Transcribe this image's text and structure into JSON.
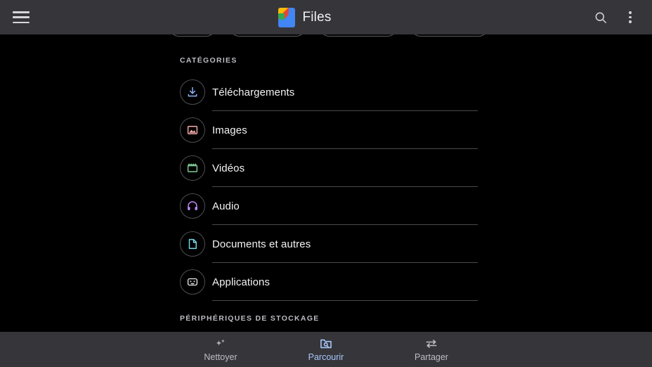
{
  "app": {
    "title": "Files",
    "logo_icon": "files-logo",
    "menu_icon": "hamburger-menu-icon",
    "search_icon": "search-icon",
    "overflow_icon": "more-vert-icon",
    "appbar_color": "#35353a",
    "background_color": "#000000"
  },
  "filter_chips": [
    {
      "name": "chip-1"
    },
    {
      "name": "chip-2"
    },
    {
      "name": "chip-3"
    },
    {
      "name": "chip-4"
    }
  ],
  "sections": {
    "categories_label": "CATÉGORIES",
    "storage_label": "PÉRIPHÉRIQUES DE STOCKAGE"
  },
  "categories": [
    {
      "label": "Téléchargements",
      "icon": "download-icon",
      "color": "#8ab4f8"
    },
    {
      "label": "Images",
      "icon": "image-icon",
      "color": "#f6aea9"
    },
    {
      "label": "Vidéos",
      "icon": "video-icon",
      "color": "#81c995"
    },
    {
      "label": "Audio",
      "icon": "headphones-icon",
      "color": "#c58af9"
    },
    {
      "label": "Documents et autres",
      "icon": "document-icon",
      "color": "#78d9ec"
    },
    {
      "label": "Applications",
      "icon": "android-apps-icon",
      "color": "#e8eaed"
    }
  ],
  "bottom_nav": {
    "active_color": "#a8c7fa",
    "inactive_color": "#bdbdc3",
    "items": [
      {
        "label": "Nettoyer",
        "icon": "sparkle-clean-icon",
        "active": false
      },
      {
        "label": "Parcourir",
        "icon": "folder-search-icon",
        "active": true
      },
      {
        "label": "Partager",
        "icon": "swap-arrows-share-icon",
        "active": false
      }
    ]
  }
}
